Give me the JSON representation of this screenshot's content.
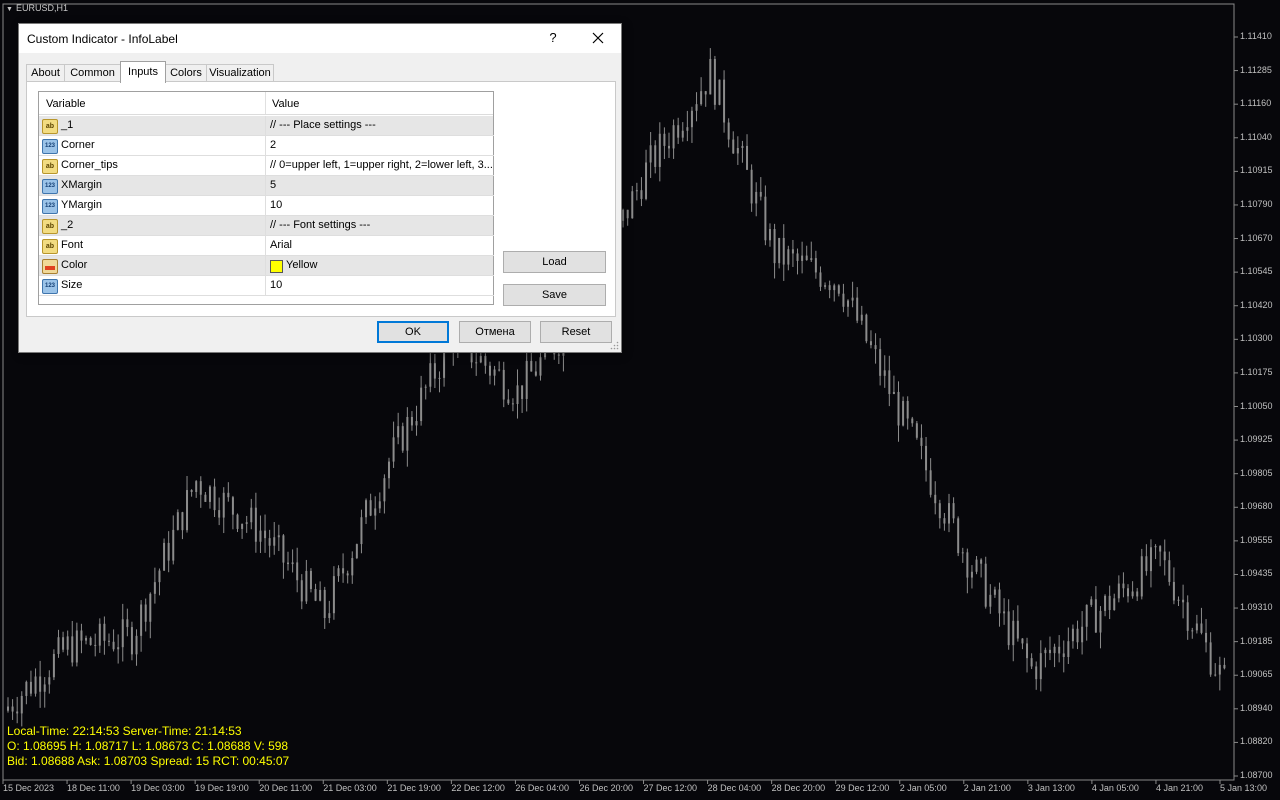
{
  "chart": {
    "symbol": "EURUSD,H1",
    "price_labels": [
      "1.11410",
      "1.11285",
      "1.11160",
      "1.11040",
      "1.10915",
      "1.10790",
      "1.10670",
      "1.10545",
      "1.10420",
      "1.10300",
      "1.10175",
      "1.10050",
      "1.09925",
      "1.09805",
      "1.09680",
      "1.09555",
      "1.09435",
      "1.09310",
      "1.09185",
      "1.09065",
      "1.08940",
      "1.08820",
      "1.08700"
    ],
    "time_labels": [
      "15 Dec 2023",
      "18 Dec 11:00",
      "19 Dec 03:00",
      "19 Dec 19:00",
      "20 Dec 11:00",
      "21 Dec 03:00",
      "21 Dec 19:00",
      "22 Dec 12:00",
      "26 Dec 04:00",
      "26 Dec 20:00",
      "27 Dec 12:00",
      "28 Dec 04:00",
      "28 Dec 20:00",
      "29 Dec 12:00",
      "2 Jan 05:00",
      "2 Jan 21:00",
      "3 Jan 13:00",
      "4 Jan 05:00",
      "4 Jan 21:00",
      "5 Jan 13:00"
    ],
    "colors": {
      "background": "#07070b",
      "candle": "#8c8c8c",
      "info_text": "#ffff00"
    },
    "info": {
      "line1": "Local-Time: 22:14:53 Server-Time: 21:14:53",
      "line2": "O: 1.08695 H: 1.08717 L: 1.08673 C: 1.08688 V: 598",
      "line3": "Bid: 1.08688 Ask: 1.08703 Spread: 15 RCT: 00:45:07"
    }
  },
  "chart_data": {
    "type": "candlestick",
    "symbol": "EURUSD",
    "timeframe": "H1",
    "ylim": [
      1.087,
      1.115
    ],
    "x": [
      "15 Dec 2023",
      "18 Dec 11:00",
      "19 Dec 03:00",
      "19 Dec 19:00",
      "20 Dec 11:00",
      "21 Dec 03:00",
      "21 Dec 19:00",
      "22 Dec 12:00",
      "26 Dec 04:00",
      "26 Dec 20:00",
      "27 Dec 12:00",
      "28 Dec 04:00",
      "28 Dec 20:00",
      "29 Dec 12:00",
      "2 Jan 05:00",
      "2 Jan 21:00",
      "3 Jan 13:00",
      "4 Jan 05:00",
      "4 Jan 21:00",
      "5 Jan 13:00"
    ],
    "close": [
      1.0895,
      1.0918,
      1.0922,
      1.0978,
      1.096,
      1.093,
      1.0985,
      1.103,
      1.101,
      1.104,
      1.109,
      1.1125,
      1.106,
      1.105,
      1.1,
      1.095,
      1.091,
      1.093,
      1.095,
      1.0905
    ]
  },
  "dialog": {
    "title": "Custom Indicator - InfoLabel",
    "help": "?",
    "tabs": [
      "About",
      "Common",
      "Inputs",
      "Colors",
      "Visualization"
    ],
    "headers": {
      "variable": "Variable",
      "value": "Value"
    },
    "rows": [
      {
        "type": "ab",
        "variable": "_1",
        "value": "// --- Place settings ---"
      },
      {
        "type": "123",
        "variable": "Corner",
        "value": "2"
      },
      {
        "type": "ab",
        "variable": "Corner_tips",
        "value": "// 0=upper left, 1=upper right, 2=lower left, 3..."
      },
      {
        "type": "123",
        "variable": "XMargin",
        "value": "5"
      },
      {
        "type": "123",
        "variable": "YMargin",
        "value": "10"
      },
      {
        "type": "ab",
        "variable": "_2",
        "value": "// --- Font settings ---"
      },
      {
        "type": "ab",
        "variable": "Font",
        "value": "Arial"
      },
      {
        "type": "color",
        "variable": "Color",
        "value": "Yellow"
      },
      {
        "type": "123",
        "variable": "Size",
        "value": "10"
      }
    ],
    "icon_text": {
      "ab": "ab",
      "num": "123"
    },
    "color_swatch": "#ffff00",
    "buttons": {
      "load": "Load",
      "save": "Save",
      "ok": "OK",
      "cancel": "Отмена",
      "reset": "Reset"
    }
  }
}
